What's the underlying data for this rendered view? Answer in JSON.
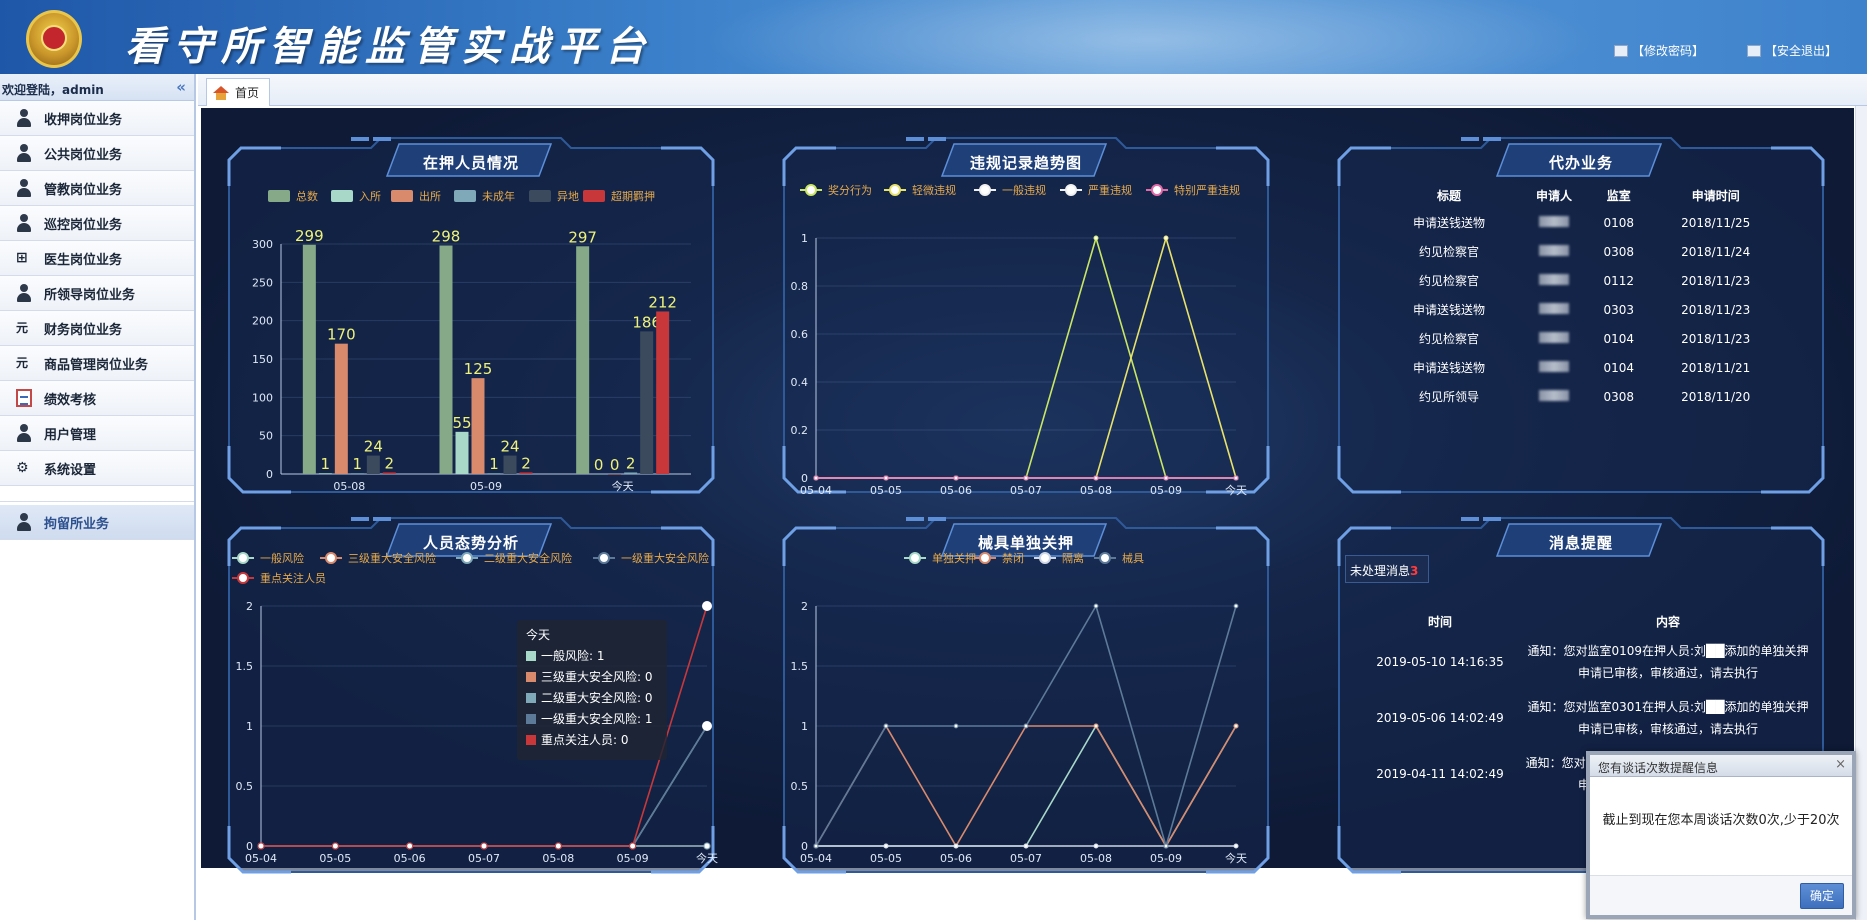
{
  "header": {
    "title": "看守所智能监管实战平台",
    "links": {
      "change_password": "【修改密码】",
      "logout": "【安全退出】"
    }
  },
  "sidebar": {
    "welcome": "欢迎登陆，admin",
    "collapse": "«",
    "items": [
      {
        "label": "收押岗位业务",
        "icon": "person-icon"
      },
      {
        "label": "公共岗位业务",
        "icon": "person-icon"
      },
      {
        "label": "管教岗位业务",
        "icon": "person-icon"
      },
      {
        "label": "巡控岗位业务",
        "icon": "person-icon"
      },
      {
        "label": "医生岗位业务",
        "icon": "plus-icon"
      },
      {
        "label": "所领导岗位业务",
        "icon": "person-icon"
      },
      {
        "label": "财务岗位业务",
        "icon": "yuan-icon"
      },
      {
        "label": "商品管理岗位业务",
        "icon": "yuan-icon"
      },
      {
        "label": "绩效考核",
        "icon": "calendar-icon"
      },
      {
        "label": "用户管理",
        "icon": "user-icon"
      },
      {
        "label": "系统设置",
        "icon": "gear-icon"
      }
    ],
    "selected_item": "拘留所业务"
  },
  "tabs": {
    "home": "首页"
  },
  "colors": {
    "bg_dark": "#0e1a36",
    "s_green": "#86aa88",
    "s_mint": "#a8d8c8",
    "s_orange": "#d98a6c",
    "s_teal": "#7fa8b8",
    "s_slate": "#3b4a5c",
    "s_red": "#c8383a",
    "s_yellowgreen": "#c8e664",
    "s_yellow": "#e8e26a",
    "s_pink": "#e36aa8"
  },
  "panels": {
    "detained": {
      "title": "在押人员情况",
      "chart_data": {
        "type": "bar",
        "categories": [
          "05-08",
          "05-09",
          "今天"
        ],
        "series": [
          {
            "name": "总数",
            "values": [
              299,
              298,
              297
            ]
          },
          {
            "name": "入所",
            "values": [
              1,
              55,
              0
            ]
          },
          {
            "name": "出所",
            "values": [
              170,
              125,
              0
            ]
          },
          {
            "name": "未成年",
            "values": [
              1,
              1,
              2
            ]
          },
          {
            "name": "异地",
            "values": [
              24,
              24,
              186
            ]
          },
          {
            "name": "超期羁押",
            "values": [
              2,
              2,
              212
            ]
          }
        ],
        "ylim": [
          0,
          300
        ],
        "yticks": [
          0,
          50,
          100,
          150,
          200,
          250,
          300
        ]
      }
    },
    "violation": {
      "title": "违规记录趋势图",
      "chart_data": {
        "type": "line",
        "categories": [
          "05-04",
          "05-05",
          "05-06",
          "05-07",
          "05-08",
          "05-09",
          "今天"
        ],
        "series": [
          {
            "name": "奖分行为",
            "values": [
              0,
              0,
              0,
              0,
              1,
              0,
              0
            ]
          },
          {
            "name": "轻微违规",
            "values": [
              0,
              0,
              0,
              0,
              0,
              1,
              0
            ]
          },
          {
            "name": "一般违规",
            "values": [
              0,
              0,
              0,
              0,
              0,
              0,
              0
            ]
          },
          {
            "name": "严重违规",
            "values": [
              0,
              0,
              0,
              0,
              0,
              0,
              0
            ]
          },
          {
            "name": "特别严重违规",
            "values": [
              0,
              0,
              0,
              0,
              0,
              0,
              0
            ]
          }
        ],
        "ylim": [
          0,
          1
        ],
        "yticks": [
          0,
          0.2,
          0.4,
          0.6,
          0.8,
          1
        ]
      }
    },
    "agency": {
      "title": "代办业务",
      "columns": [
        "标题",
        "申请人",
        "监室",
        "申请时间"
      ],
      "rows": [
        {
          "title": "申请送钱送物",
          "room": "0108",
          "date": "2018/11/25"
        },
        {
          "title": "约见检察官",
          "room": "0308",
          "date": "2018/11/24"
        },
        {
          "title": "约见检察官",
          "room": "0112",
          "date": "2018/11/23"
        },
        {
          "title": "申请送钱送物",
          "room": "0303",
          "date": "2018/11/23"
        },
        {
          "title": "约见检察官",
          "room": "0104",
          "date": "2018/11/23"
        },
        {
          "title": "申请送钱送物",
          "room": "0104",
          "date": "2018/11/21"
        },
        {
          "title": "约见所领导",
          "room": "0308",
          "date": "2018/11/20"
        }
      ]
    },
    "situation": {
      "title": "人员态势分析",
      "chart_data": {
        "type": "line",
        "categories": [
          "05-04",
          "05-05",
          "05-06",
          "05-07",
          "05-08",
          "05-09",
          "今天"
        ],
        "series": [
          {
            "name": "一般风险",
            "values": [
              0,
              0,
              0,
              0,
              0,
              0,
              1
            ]
          },
          {
            "name": "三级重大安全风险",
            "values": [
              0,
              0,
              0,
              0,
              0,
              0,
              0
            ]
          },
          {
            "name": "二级重大安全风险",
            "values": [
              0,
              0,
              0,
              0,
              0,
              0,
              0
            ]
          },
          {
            "name": "一级重大安全风险",
            "values": [
              0,
              0,
              0,
              0,
              0,
              0,
              1
            ]
          },
          {
            "name": "重点关注人员",
            "values": [
              0,
              0,
              0,
              0,
              0,
              0,
              2
            ]
          }
        ],
        "ylim": [
          0,
          2
        ],
        "yticks": [
          0,
          0.5,
          1,
          1.5,
          2
        ]
      },
      "tooltip": {
        "title": "今天",
        "rows": [
          "一般风险: 1",
          "三级重大安全风险: 0",
          "二级重大安全风险: 0",
          "一级重大安全风险: 1",
          "重点关注人员: 0"
        ]
      }
    },
    "restraint": {
      "title": "械具单独关押",
      "chart_data": {
        "type": "line",
        "categories": [
          "05-04",
          "05-05",
          "05-06",
          "05-07",
          "05-08",
          "05-09",
          "今天"
        ],
        "series": [
          {
            "name": "单独关押",
            "values": [
              0,
              0,
              0,
              0,
              1,
              0,
              1
            ]
          },
          {
            "name": "禁闭",
            "values": [
              0,
              1,
              0,
              1,
              1,
              0,
              1
            ]
          },
          {
            "name": "隔离",
            "values": [
              0,
              0,
              0,
              0,
              0,
              0,
              0
            ]
          },
          {
            "name": "械具",
            "values": [
              0,
              1,
              1,
              1,
              2,
              0,
              2
            ]
          }
        ],
        "ylim": [
          0,
          2
        ],
        "yticks": [
          0,
          0.5,
          1,
          1.5,
          2
        ]
      }
    },
    "messages": {
      "title": "消息提醒",
      "unprocessed_label": "未处理消息",
      "unprocessed_count": "3",
      "columns": [
        "时间",
        "内容"
      ],
      "rows": [
        {
          "time": "2019-05-10 14:16:35",
          "content": "通知：您对监室0109在押人员:刘██添加的单独关押申请已审核，审核通过，请去执行"
        },
        {
          "time": "2019-05-06 14:02:49",
          "content": "通知：您对监室0301在押人员:刘██添加的单独关押申请已审核，审核通过，请去执行"
        },
        {
          "time": "2019-04-11 14:02:49",
          "content": "通知：您对监室████在押人员:███添加的单独关押申请已审核，审核通过，请去执行"
        }
      ]
    }
  },
  "dialog": {
    "title": "您有谈话次数提醒信息",
    "close": "×",
    "message": "截止到现在您本周谈话次数0次,少于20次",
    "ok": "确定"
  }
}
